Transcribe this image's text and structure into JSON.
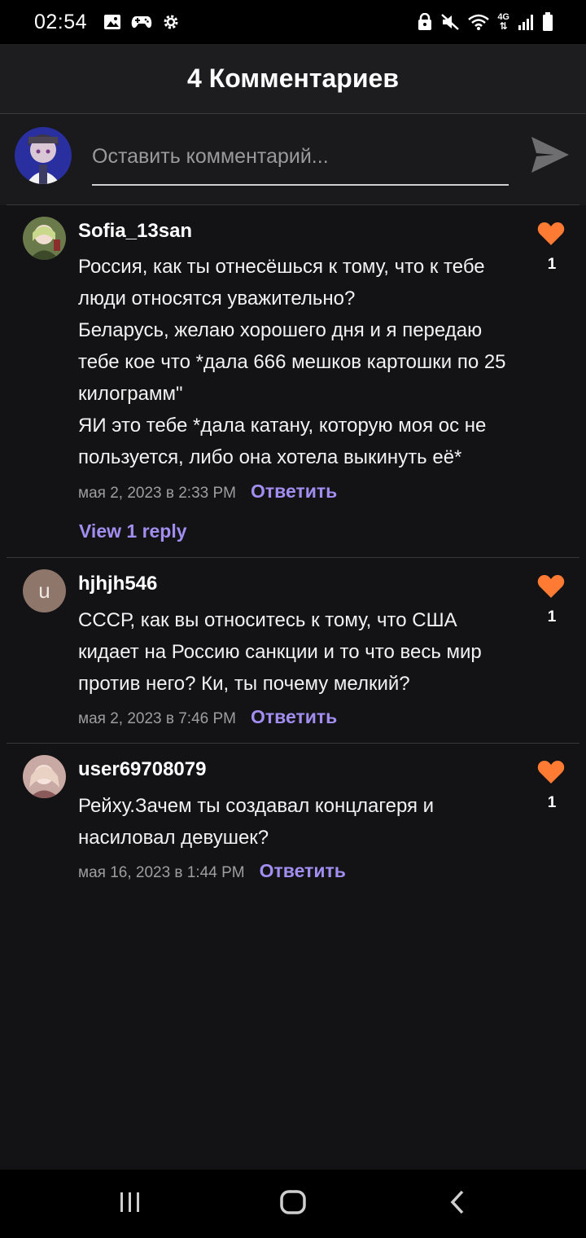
{
  "status_bar": {
    "time": "02:54",
    "left_icons": [
      "image-icon",
      "gamepad-icon",
      "settings-icon"
    ],
    "right_icons": [
      "lock-icon",
      "mute-icon",
      "wifi-icon",
      "network-4g-icon",
      "signal-icon",
      "battery-icon"
    ],
    "network_label": "4G"
  },
  "header": {
    "title": "4 Комментариев"
  },
  "composer": {
    "placeholder": "Оставить комментарий...",
    "value": "",
    "send_icon": "send-icon"
  },
  "colors": {
    "background": "#131214",
    "accent": "#a18ef0",
    "like": "#ff7a33"
  },
  "comments": [
    {
      "author": "Sofia_13san",
      "text": "Россия, как ты отнесёшься к тому, что к тебе люди относятся уважительно?\nБеларусь, желаю хорошего дня и я передаю тебе кое что *дала 666 мешков  картошки по 25 килограмм\"\nЯИ это тебе *дала катану, которую моя ос не пользуется, либо она хотела выкинуть её*",
      "date": "мая 2, 2023 в 2:33 PM",
      "reply_label": "Ответить",
      "likes": "1",
      "view_replies": "View 1 reply"
    },
    {
      "author": "hjhjh546",
      "avatar_letter": "u",
      "text": "СССР, как вы относитесь к тому, что США кидает на Россию санкции и то что весь мир против него?   Ки, ты почему мелкий?",
      "date": "мая 2, 2023 в 7:46 PM",
      "reply_label": "Ответить",
      "likes": "1"
    },
    {
      "author": "user69708079",
      "text": "Рейху.Зачем ты создавал концлагеря и насиловал девушек?",
      "date": "мая 16, 2023 в 1:44 PM",
      "reply_label": "Ответить",
      "likes": "1"
    }
  ],
  "nav_bar": {
    "icons": [
      "recent-apps-icon",
      "home-icon",
      "back-icon"
    ]
  }
}
